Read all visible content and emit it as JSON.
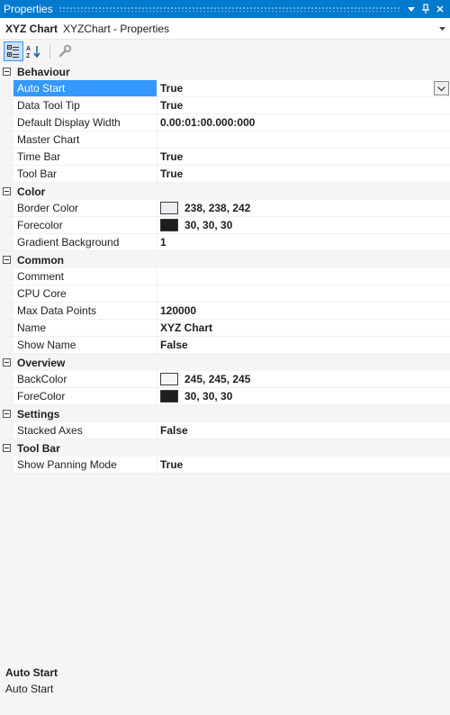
{
  "window": {
    "title": "Properties"
  },
  "object_selector": {
    "name": "XYZ Chart",
    "type": "XYZChart - Properties"
  },
  "icons": {
    "categorized": "categorized-icon",
    "alphabetical": "alphabetical-icon",
    "property_pages": "wrench-icon"
  },
  "colors": {
    "accent": "#007acc",
    "selection": "#3399ff"
  },
  "categories": [
    {
      "label": "Behaviour",
      "rows": [
        {
          "name": "Auto Start",
          "value": "True",
          "selected": true
        },
        {
          "name": "Data Tool Tip",
          "value": "True"
        },
        {
          "name": "Default Display Width",
          "value": "0.00:01:00.000:000"
        },
        {
          "name": "Master Chart",
          "value": ""
        },
        {
          "name": "Time Bar",
          "value": "True"
        },
        {
          "name": "Tool Bar",
          "value": "True"
        }
      ]
    },
    {
      "label": "Color",
      "rows": [
        {
          "name": "Border Color",
          "value": "238, 238, 242",
          "swatch": "#eeeef2"
        },
        {
          "name": "Forecolor",
          "value": "30, 30, 30",
          "swatch": "#1e1e1e"
        },
        {
          "name": "Gradient Background",
          "value": "1"
        }
      ]
    },
    {
      "label": "Common",
      "rows": [
        {
          "name": "Comment",
          "value": ""
        },
        {
          "name": "CPU Core",
          "value": ""
        },
        {
          "name": "Max Data Points",
          "value": "120000"
        },
        {
          "name": "Name",
          "value": "XYZ Chart"
        },
        {
          "name": "Show Name",
          "value": "False"
        }
      ]
    },
    {
      "label": "Overview",
      "rows": [
        {
          "name": "BackColor",
          "value": "245, 245, 245",
          "swatch": "#f5f5f5"
        },
        {
          "name": "ForeColor",
          "value": "30, 30, 30",
          "swatch": "#1e1e1e"
        }
      ]
    },
    {
      "label": "Settings",
      "rows": [
        {
          "name": "Stacked Axes",
          "value": "False"
        }
      ]
    },
    {
      "label": "Tool Bar",
      "rows": [
        {
          "name": "Show Panning Mode",
          "value": "True"
        }
      ]
    }
  ],
  "description": {
    "title": "Auto Start",
    "text": "Auto Start"
  }
}
